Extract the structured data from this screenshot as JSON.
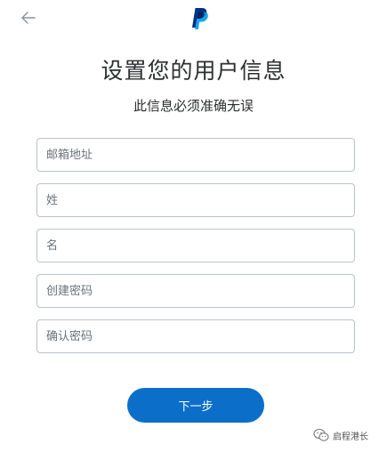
{
  "header": {
    "back_icon": "arrow-left-icon",
    "logo_icon": "paypal-logo-icon",
    "brand_color": "#003087",
    "brand_color_light": "#009cde"
  },
  "main": {
    "title": "设置您的用户信息",
    "subtitle": "此信息必须准确无误",
    "fields": [
      {
        "placeholder": "邮箱地址",
        "value": ""
      },
      {
        "placeholder": "姓",
        "value": ""
      },
      {
        "placeholder": "名",
        "value": ""
      },
      {
        "placeholder": "创建密码",
        "value": ""
      },
      {
        "placeholder": "确认密码",
        "value": ""
      }
    ],
    "next_button_label": "下一步",
    "accent_color": "#0b6fc9"
  },
  "watermark": {
    "icon": "wechat-icon",
    "label": "启程港长"
  }
}
